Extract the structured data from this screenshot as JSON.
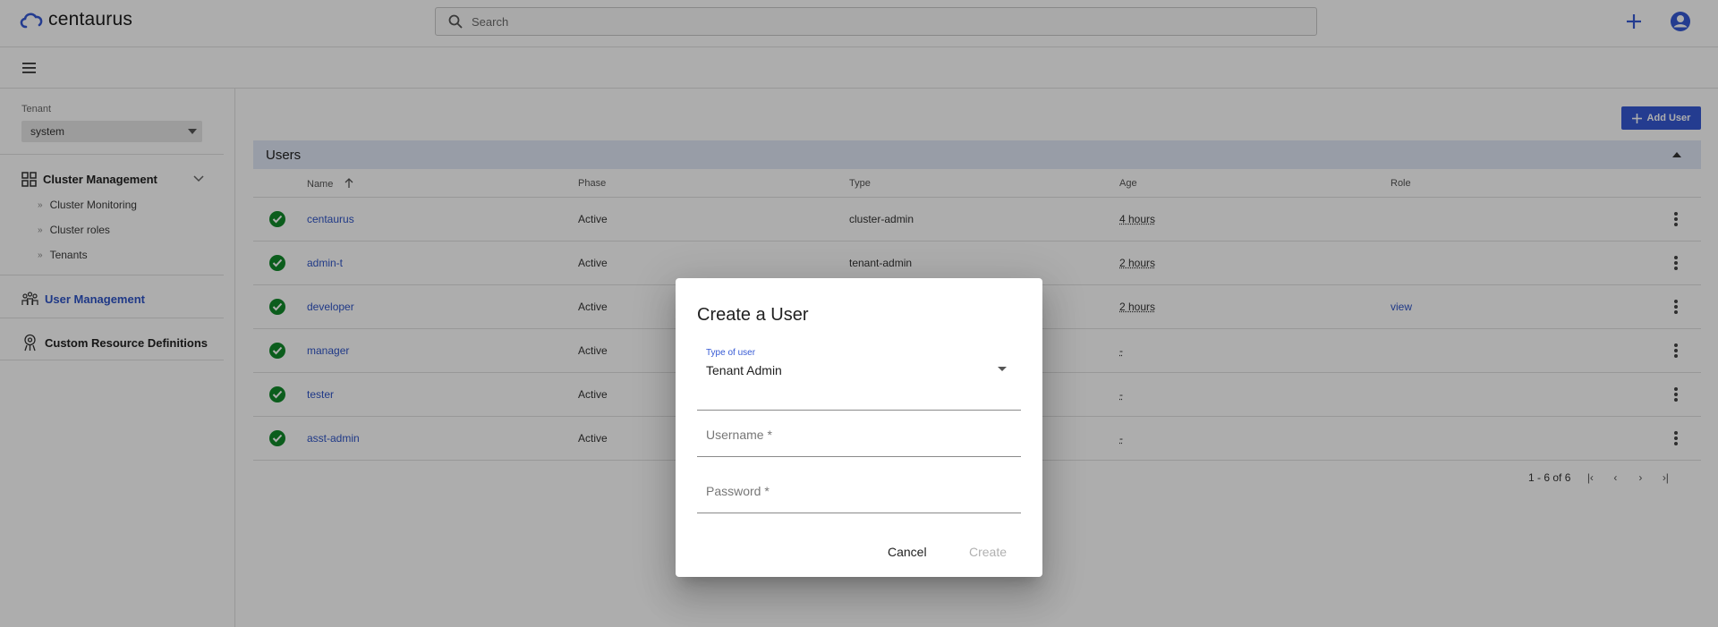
{
  "app": {
    "name": "centaurus"
  },
  "search": {
    "placeholder": "Search"
  },
  "sidebar": {
    "tenant_label": "Tenant",
    "tenant_value": "system",
    "groups": [
      {
        "label": "Cluster Management",
        "items": [
          "Cluster Monitoring",
          "Cluster roles",
          "Tenants"
        ]
      },
      {
        "label": "User Management"
      },
      {
        "label": "Custom Resource Definitions"
      }
    ]
  },
  "main": {
    "add_user_label": "Add User",
    "section_title": "Users",
    "columns": [
      "Name",
      "Phase",
      "Type",
      "Age",
      "Role"
    ],
    "rows": [
      {
        "name": "centaurus",
        "phase": "Active",
        "type": "cluster-admin",
        "age": "4 hours",
        "role": ""
      },
      {
        "name": "admin-t",
        "phase": "Active",
        "type": "tenant-admin",
        "age": "2 hours",
        "role": ""
      },
      {
        "name": "developer",
        "phase": "Active",
        "type": "",
        "age": "2 hours",
        "role": "view"
      },
      {
        "name": "manager",
        "phase": "Active",
        "type": "",
        "age": "-",
        "role": ""
      },
      {
        "name": "tester",
        "phase": "Active",
        "type": "",
        "age": "-",
        "role": ""
      },
      {
        "name": "asst-admin",
        "phase": "Active",
        "type": "",
        "age": "-",
        "role": ""
      }
    ],
    "pagination": {
      "range": "1 - 6 of 6"
    }
  },
  "dialog": {
    "title": "Create a User",
    "type_label": "Type of user",
    "type_value": "Tenant Admin",
    "username_placeholder": "Username *",
    "password_placeholder": "Password *",
    "cancel_label": "Cancel",
    "create_label": "Create"
  },
  "colors": {
    "accent": "#3559d4",
    "status_ok": "#118a2a",
    "header_bg": "#e1e7f7"
  }
}
